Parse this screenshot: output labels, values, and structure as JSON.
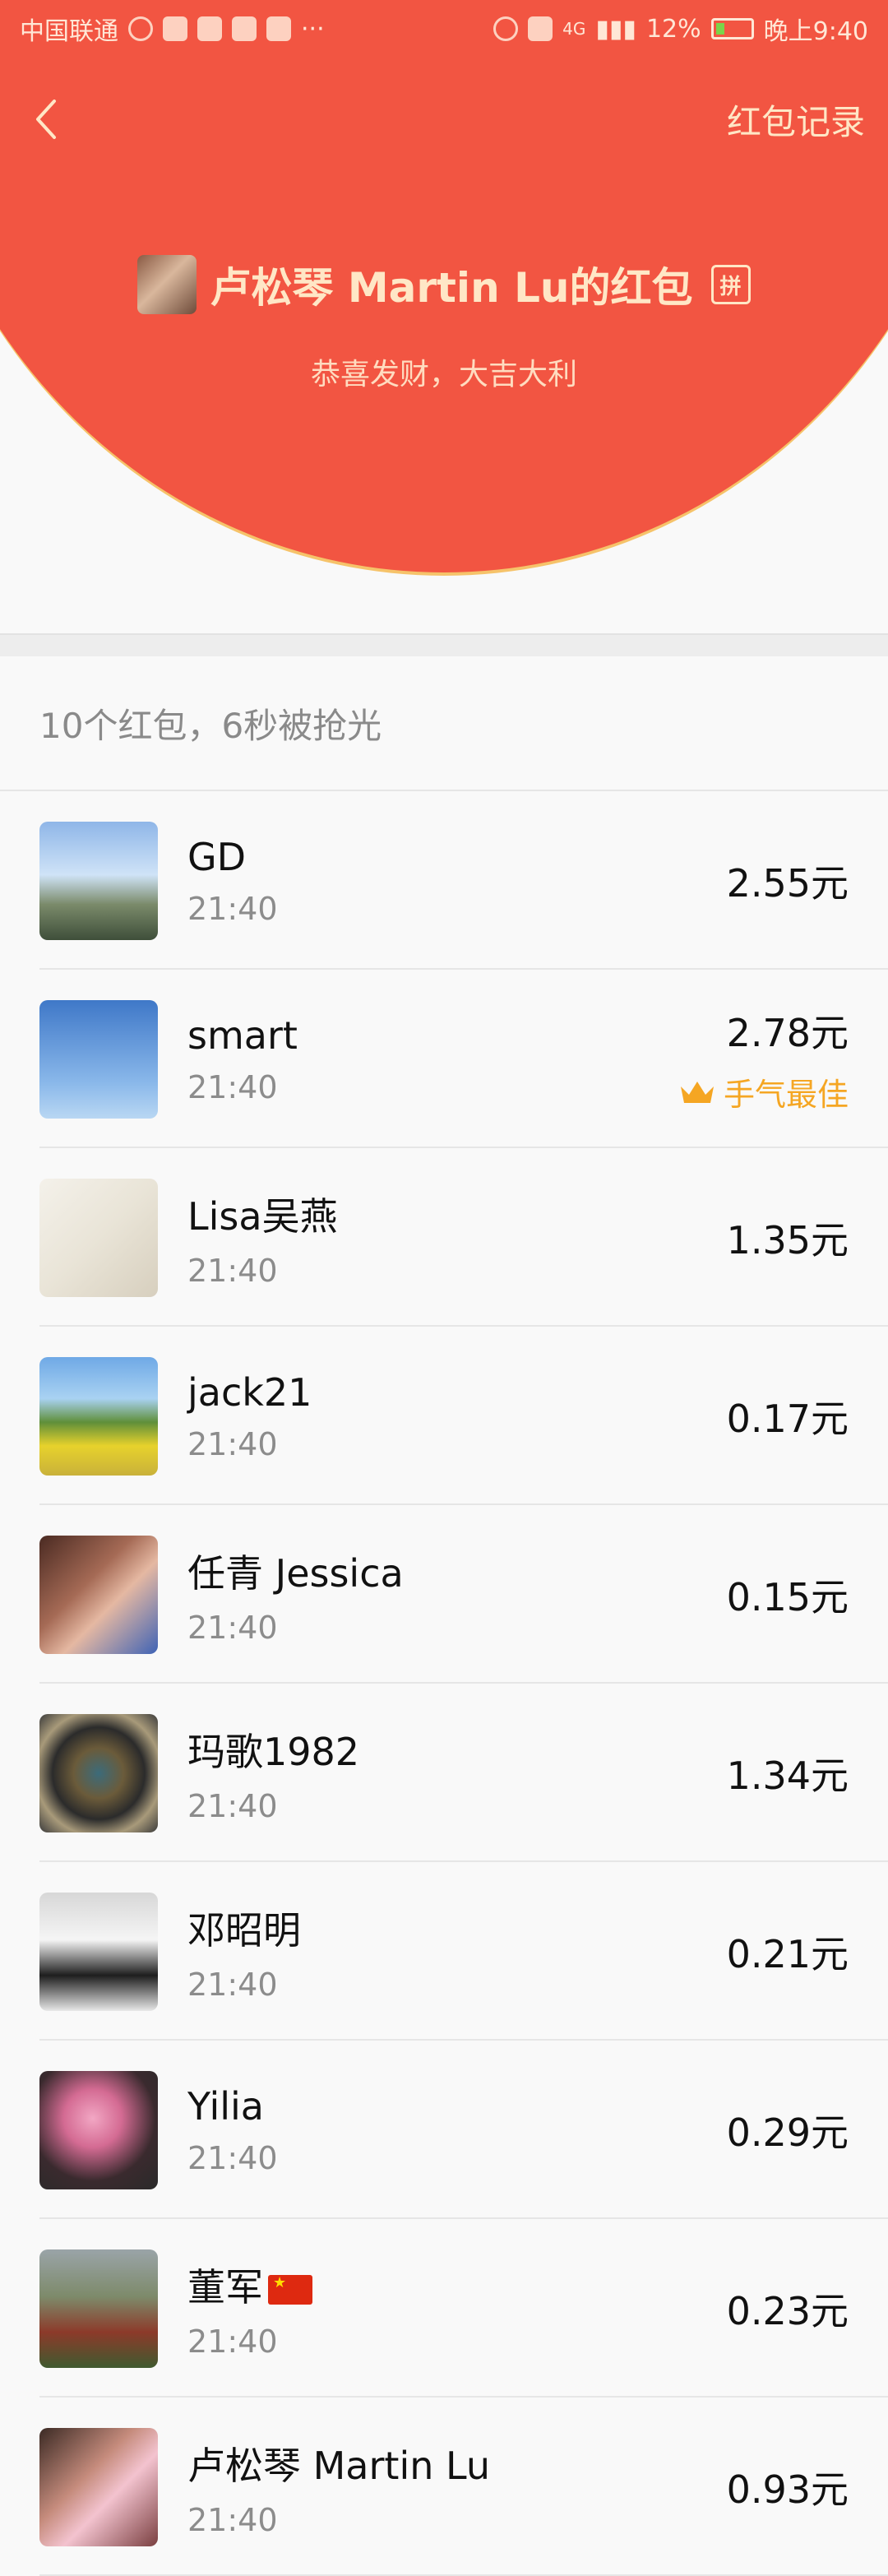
{
  "status_bar": {
    "carrier": "中国联通",
    "signal_label": "4G",
    "battery": "12%",
    "time": "晚上9:40"
  },
  "nav": {
    "back_icon": "chevron-left-icon",
    "record_label": "红包记录"
  },
  "owner": {
    "name": "卢松琴 Martin Lu的红包",
    "badge": "拼",
    "blessing": "恭喜发财，大吉大利"
  },
  "summary": "10个红包，6秒被抢光",
  "best_label": "手气最佳",
  "records": [
    {
      "name": "GD",
      "time": "21:40",
      "amount": "2.55元",
      "best": false
    },
    {
      "name": "smart",
      "time": "21:40",
      "amount": "2.78元",
      "best": true
    },
    {
      "name": "Lisa吴燕",
      "time": "21:40",
      "amount": "1.35元",
      "best": false
    },
    {
      "name": "jack21",
      "time": "21:40",
      "amount": "0.17元",
      "best": false
    },
    {
      "name": "任青 Jessica",
      "time": "21:40",
      "amount": "0.15元",
      "best": false
    },
    {
      "name": "玛歌1982",
      "time": "21:40",
      "amount": "1.34元",
      "best": false
    },
    {
      "name": "邓昭明",
      "time": "21:40",
      "amount": "0.21元",
      "best": false
    },
    {
      "name": "Yilia",
      "time": "21:40",
      "amount": "0.29元",
      "best": false
    },
    {
      "name": "董军",
      "time": "21:40",
      "amount": "0.23元",
      "best": false,
      "flag": "china-flag-icon"
    },
    {
      "name": "卢松琴 Martin Lu",
      "time": "21:40",
      "amount": "0.93元",
      "best": false
    }
  ],
  "colors": {
    "header_red": "#f25542",
    "gold_text": "#ffe7c6",
    "best_orange": "#f5a623"
  }
}
